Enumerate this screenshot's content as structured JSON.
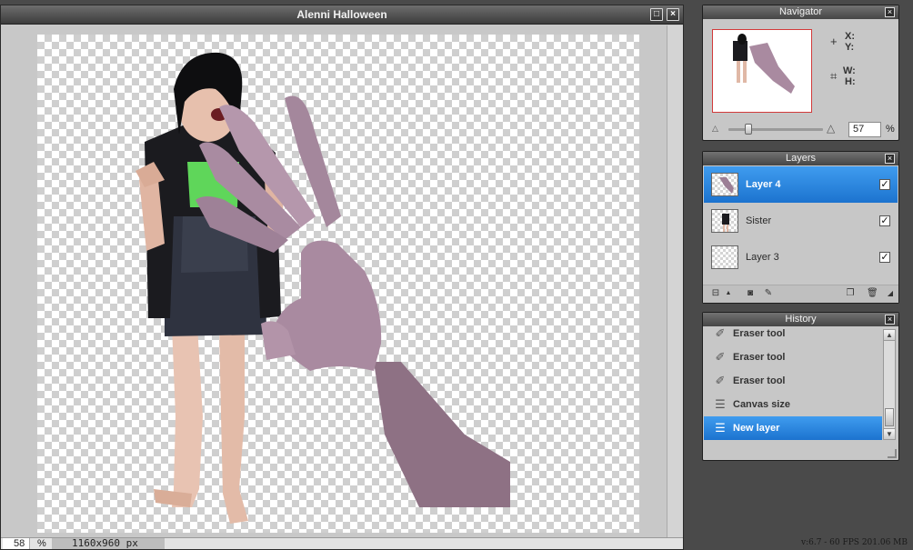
{
  "document": {
    "title": "Alenni Halloween",
    "zoom_value": "58",
    "zoom_unit": "%",
    "size_label": "1160x960 px"
  },
  "navigator": {
    "title": "Navigator",
    "x_label": "X:",
    "y_label": "Y:",
    "w_label": "W:",
    "h_label": "H:",
    "zoom_value": "57",
    "zoom_unit": "%"
  },
  "layers": {
    "title": "Layers",
    "items": [
      {
        "name": "Layer 4",
        "visible": true,
        "selected": true
      },
      {
        "name": "Sister",
        "visible": true,
        "selected": false
      },
      {
        "name": "Layer 3",
        "visible": true,
        "selected": false
      }
    ]
  },
  "history": {
    "title": "History",
    "items": [
      {
        "label": "Eraser tool",
        "icon": "eraser-icon",
        "selected": false
      },
      {
        "label": "Eraser tool",
        "icon": "eraser-icon",
        "selected": false
      },
      {
        "label": "Eraser tool",
        "icon": "eraser-icon",
        "selected": false
      },
      {
        "label": "Canvas size",
        "icon": "document-icon",
        "selected": false
      },
      {
        "label": "New layer",
        "icon": "document-icon",
        "selected": true
      }
    ]
  },
  "status": {
    "text": "v:6.7 - 60 FPS 201.06 MB"
  },
  "glyphs": {
    "close": "×",
    "maximize": "□",
    "check": "✓",
    "scroll_up": "▲",
    "scroll_down": "▼"
  },
  "colors": {
    "selection": "#2b86e0",
    "titlebar": "#4a4a4a",
    "panel": "#c7c7c7"
  }
}
